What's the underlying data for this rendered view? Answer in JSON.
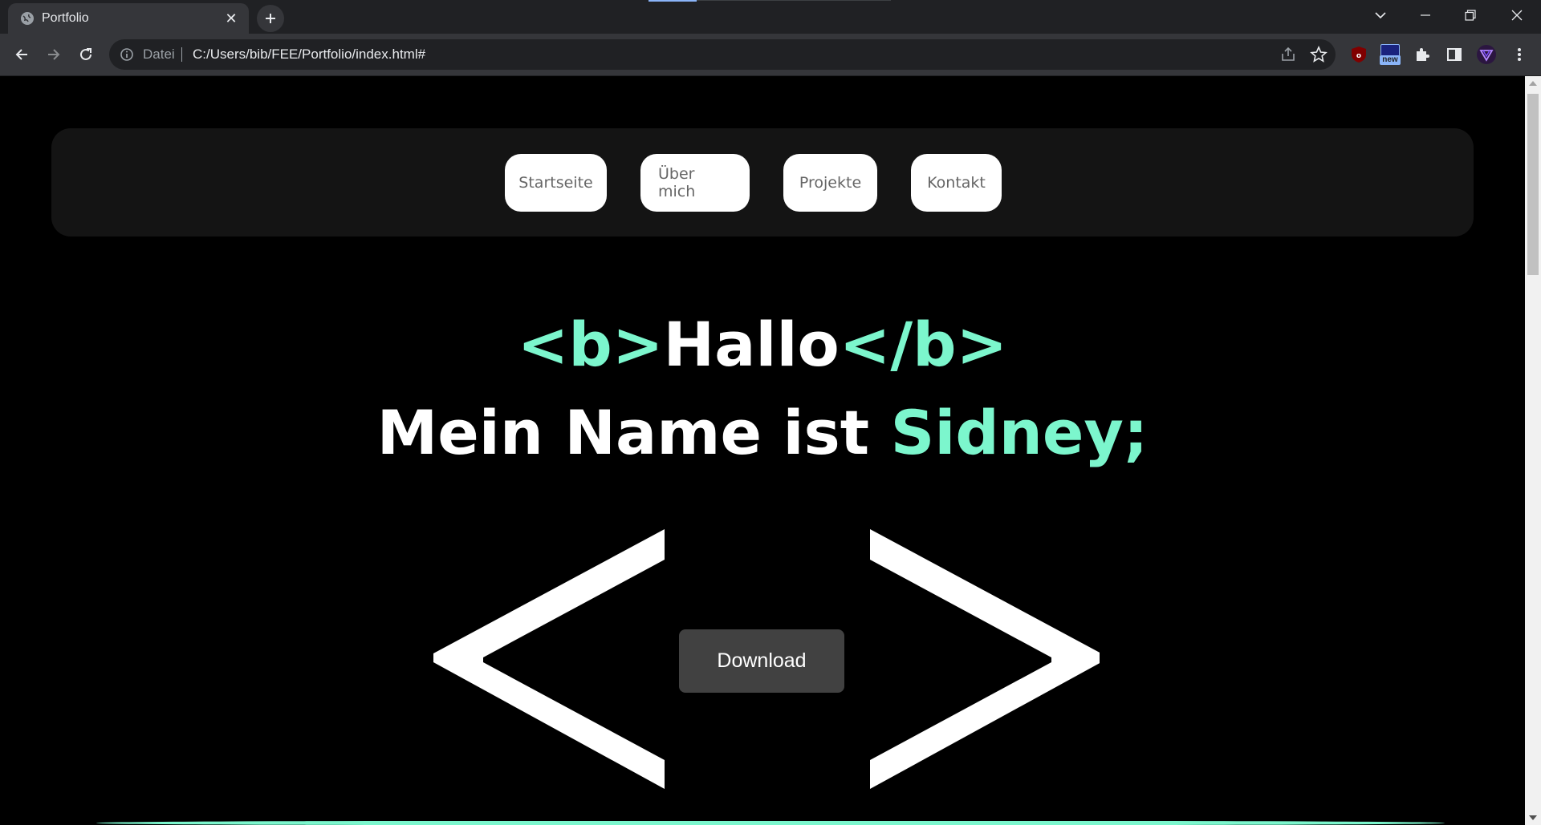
{
  "browser": {
    "tab_title": "Portfolio",
    "omnibox_label": "Datei",
    "url": "C:/Users/bib/FEE/Portfolio/index.html#",
    "extension_badge": "new",
    "accent_color": "#7cf6cd"
  },
  "nav": {
    "items": [
      {
        "label": "Startseite"
      },
      {
        "label": "Über mich"
      },
      {
        "label": "Projekte"
      },
      {
        "label": "Kontakt"
      }
    ]
  },
  "hero": {
    "open_tag": "<b>",
    "greeting": "Hallo",
    "close_tag": "</b>",
    "name_prefix": "Mein Name ist ",
    "name": "Sidney;"
  },
  "download": {
    "label": "Download"
  }
}
